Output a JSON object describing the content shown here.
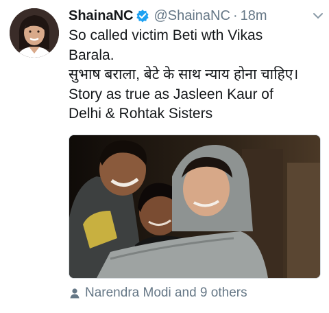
{
  "tweet": {
    "display_name": "ShainaNC",
    "handle": "@ShainaNC",
    "separator": "·",
    "time": "18m",
    "text_lines": [
      "So called victim Beti wth Vikas",
      "Barala.",
      "सुभाष बराला, बेटे के साथ न्याय होना चाहिए।",
      "Story as true as Jasleen Kaur of",
      "Delhi & Rohtak Sisters"
    ],
    "likers_text": "Narendra Modi and 9 others"
  },
  "icons": {
    "verified": "verified-badge-icon",
    "caret": "chevron-down-icon",
    "likers": "person-icon"
  },
  "colors": {
    "accent": "#1da1f2",
    "secondary_text": "#657786",
    "primary_text": "#14171a"
  }
}
